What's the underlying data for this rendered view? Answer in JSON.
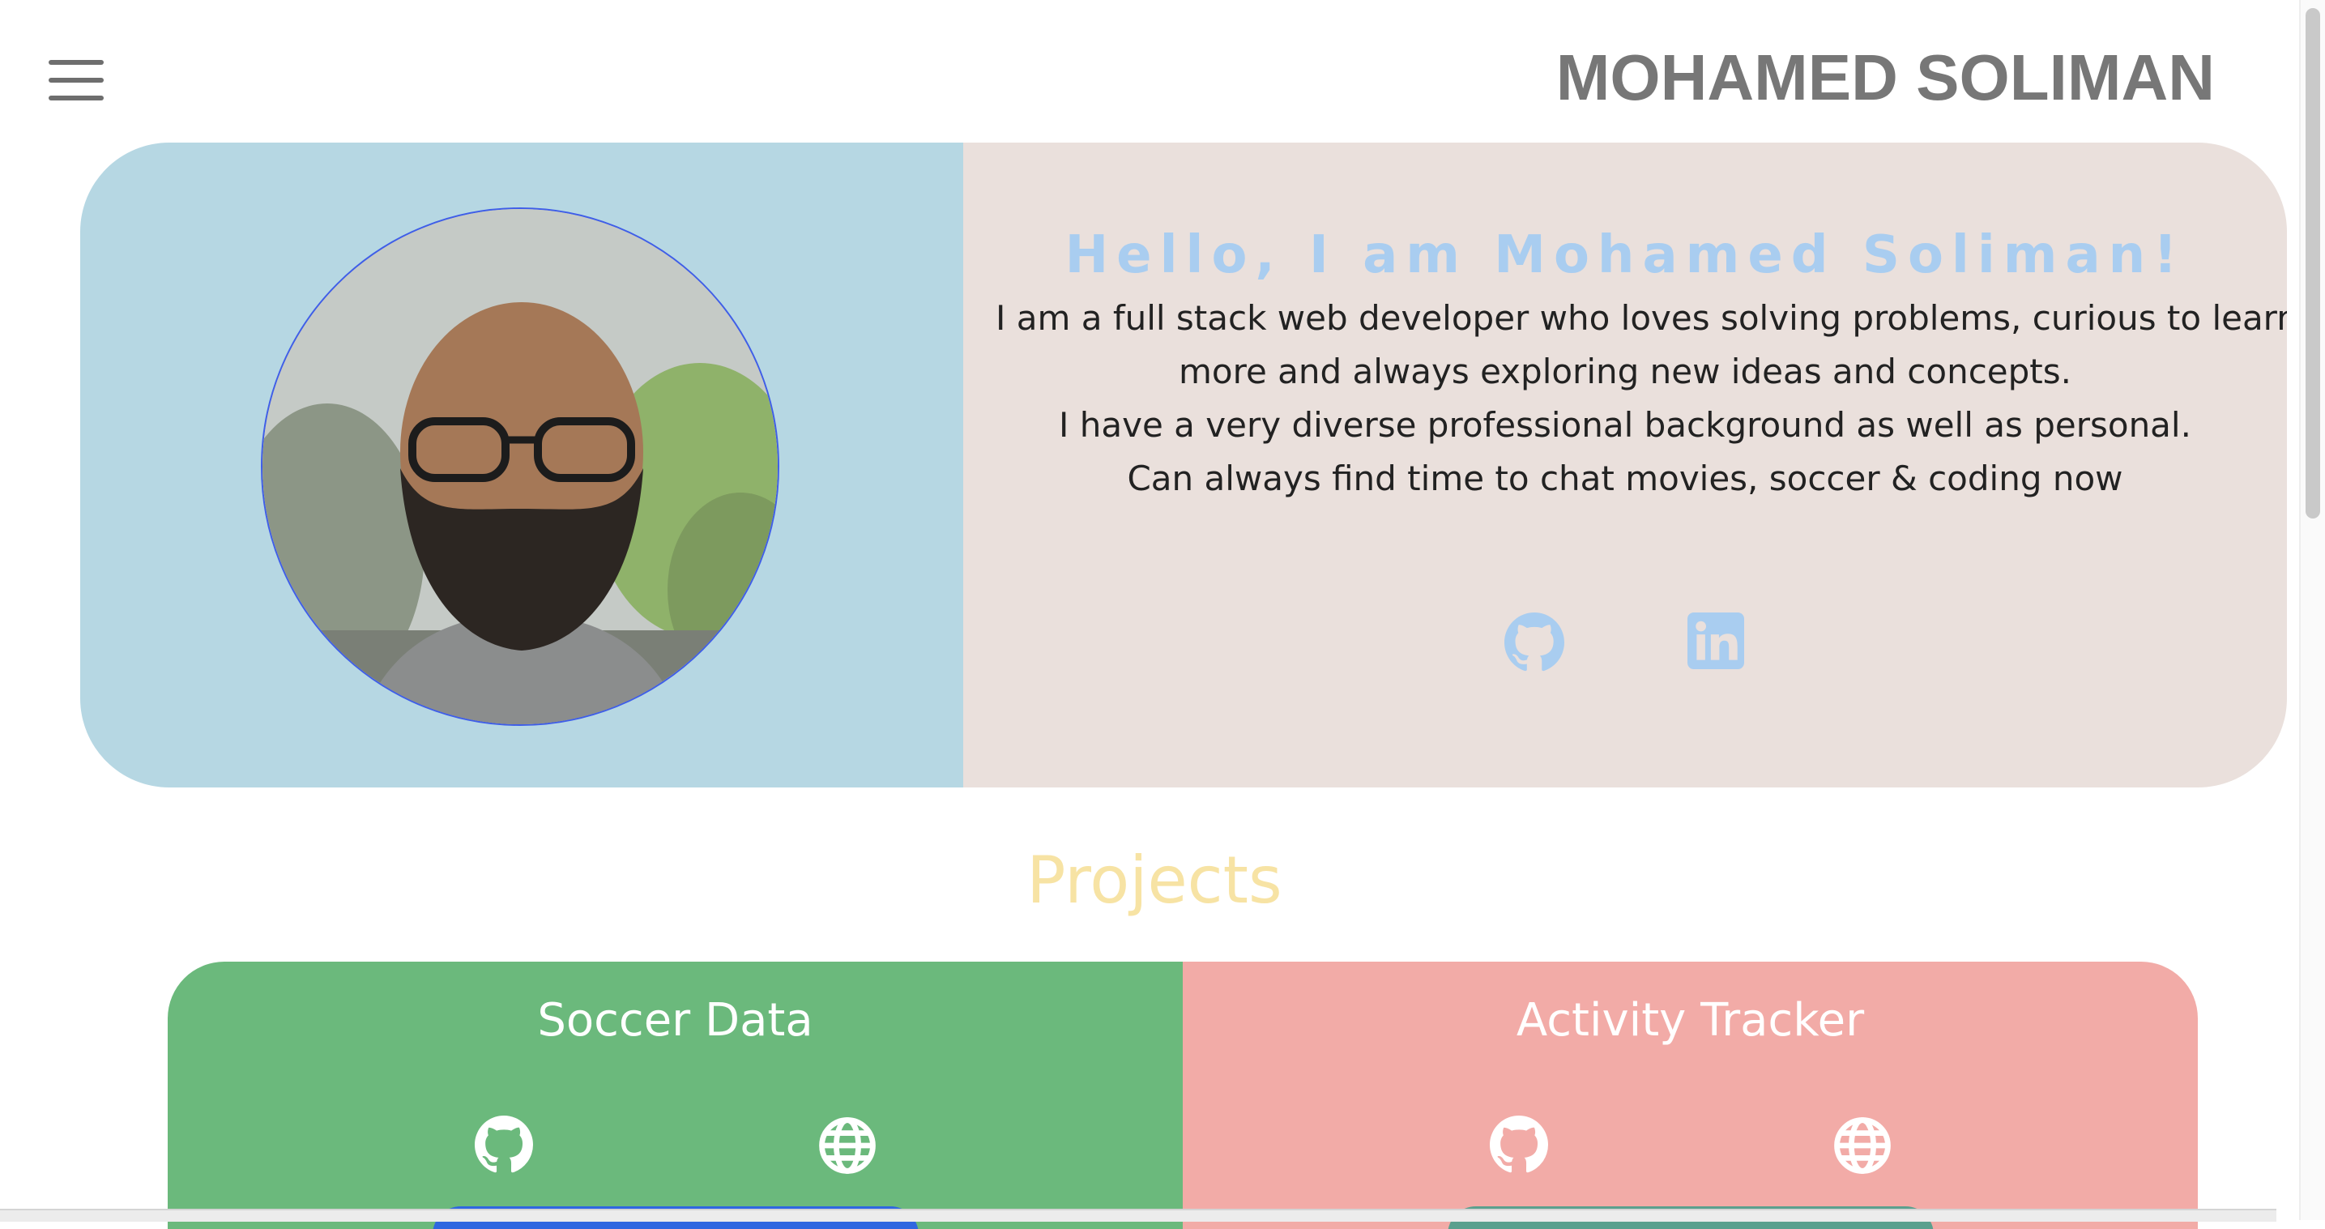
{
  "header": {
    "menu_icon": "hamburger-menu-icon",
    "title": "MOHAMED SOLIMAN"
  },
  "hero": {
    "heading": "Hello, I am Mohamed Soliman!",
    "bio_lines": [
      "I am a full stack web developer who loves solving problems, curious to learn",
      "more and always exploring new ideas and concepts.",
      "I have a very diverse professional background as well as personal.",
      "Can always find time to chat movies, soccer & coding now"
    ],
    "links": [
      {
        "icon": "github-icon"
      },
      {
        "icon": "linkedin-icon"
      }
    ]
  },
  "projects_section": {
    "title": "Projects",
    "items": [
      {
        "title": "Soccer Data",
        "color": "#6bb97c",
        "button_color": "#2f67e0",
        "links": [
          "github-icon",
          "globe-icon"
        ]
      },
      {
        "title": "Activity Tracker",
        "color": "#f2aba7",
        "button_color": "#5aa08e",
        "links": [
          "github-icon",
          "globe-icon"
        ]
      }
    ]
  },
  "colors": {
    "hero_left": "#b6d7e3",
    "hero_right": "#eae0dc",
    "heading": "#a9cdf0",
    "projects_title": "#f7e3a4",
    "header_title": "#777777"
  }
}
